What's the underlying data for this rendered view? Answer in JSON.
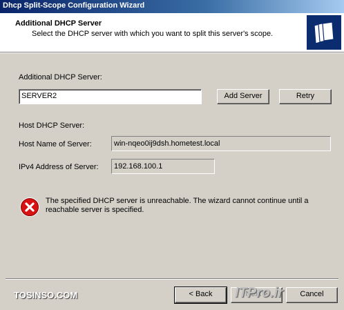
{
  "window": {
    "title": "Dhcp Split-Scope Configuration Wizard"
  },
  "header": {
    "title": "Additional DHCP Server",
    "subtitle": "Select the DHCP server with which you want to split this server's scope."
  },
  "additional": {
    "label": "Additional DHCP Server:",
    "value": "SERVER2",
    "add_button": "Add Server",
    "retry_button": "Retry"
  },
  "host": {
    "section_label": "Host DHCP Server:",
    "name_label": "Host Name of Server:",
    "name_value": "win-nqeo0ij9dsh.hometest.local",
    "ip_label": "IPv4 Address of Server:",
    "ip_value": "192.168.100.1"
  },
  "error": {
    "message": "The specified DHCP server is unreachable. The wizard cannot continue until a reachable server is specified."
  },
  "footer": {
    "back_button": "< Back",
    "next_button": "Next >",
    "cancel_button": "Cancel"
  },
  "watermark": {
    "left": "TOSINSO.COM",
    "right": "ITPro.ir"
  }
}
